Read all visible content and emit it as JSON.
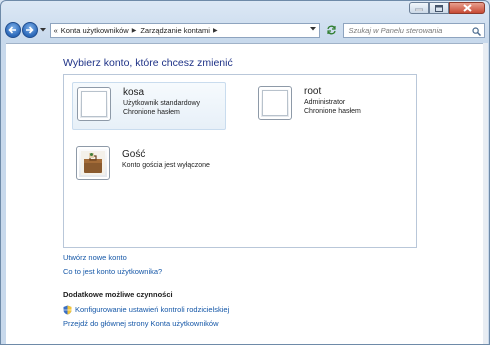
{
  "breadcrumbs": [
    "Konta użytkowników",
    "Zarządzanie kontami"
  ],
  "search": {
    "placeholder": "Szukaj w Panelu sterowania"
  },
  "heading": "Wybierz konto, które chcesz zmienić",
  "accounts": [
    {
      "name": "kosa",
      "type": "Użytkownik standardowy",
      "status": "Chronione hasłem",
      "selected": true
    },
    {
      "name": "root",
      "type": "Administrator",
      "status": "Chronione hasłem",
      "selected": false
    },
    {
      "name": "Gość",
      "type": "Konto gościa jest wyłączone"
    }
  ],
  "links": {
    "create_account": "Utwórz nowe konto",
    "what_is_account": "Co to jest konto użytkownika?"
  },
  "additional": {
    "title": "Dodatkowe możliwe czynności",
    "parental_controls": "Konfigurowanie ustawień kontroli rodzicielskiej",
    "main_page": "Przejdź do głównej strony Konta użytkowników"
  },
  "colors": {
    "heading": "#1e3287",
    "link": "#1658a8",
    "close_button": "#c74a35"
  },
  "icons": [
    "minimize-icon",
    "maximize-icon",
    "close-icon",
    "back-arrow-icon",
    "forward-arrow-icon",
    "refresh-icon",
    "search-icon",
    "shield-icon",
    "briefcase-icon"
  ]
}
